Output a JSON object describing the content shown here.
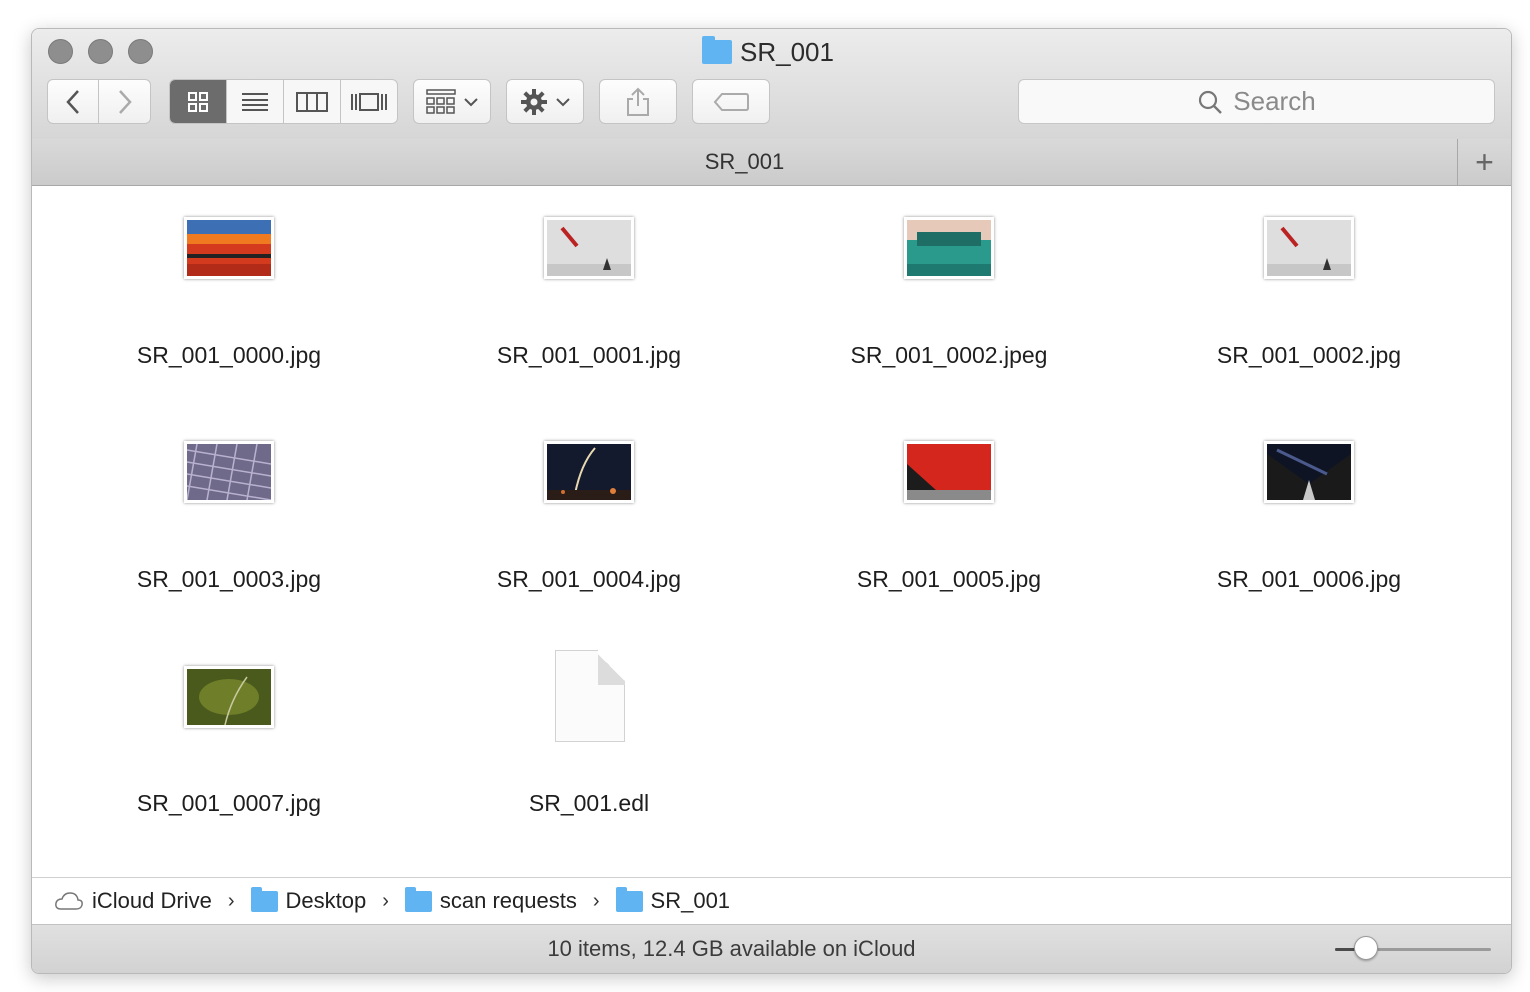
{
  "window": {
    "title": "SR_001",
    "tab_label": "SR_001",
    "tab_add": "+"
  },
  "toolbar": {
    "back": "‹",
    "forward": "›",
    "views": [
      "icon-view",
      "list-view",
      "column-view",
      "cover-flow-view"
    ],
    "active_view": "icon-view",
    "search_placeholder": "Search"
  },
  "files": [
    {
      "name": "SR_001_0000.jpg",
      "kind": "image",
      "thumb": "red-building"
    },
    {
      "name": "SR_001_0001.jpg",
      "kind": "image",
      "thumb": "kite-figure"
    },
    {
      "name": "SR_001_0002.jpeg",
      "kind": "image",
      "thumb": "teal-car"
    },
    {
      "name": "SR_001_0002.jpg",
      "kind": "image",
      "thumb": "kite-figure"
    },
    {
      "name": "SR_001_0003.jpg",
      "kind": "image",
      "thumb": "grid-pattern"
    },
    {
      "name": "SR_001_0004.jpg",
      "kind": "image",
      "thumb": "night-rocket"
    },
    {
      "name": "SR_001_0005.jpg",
      "kind": "image",
      "thumb": "red-wall"
    },
    {
      "name": "SR_001_0006.jpg",
      "kind": "image",
      "thumb": "night-road"
    },
    {
      "name": "SR_001_0007.jpg",
      "kind": "image",
      "thumb": "green-field"
    },
    {
      "name": "SR_001.edl",
      "kind": "document",
      "thumb": "document-icon"
    }
  ],
  "path": [
    {
      "label": "iCloud Drive",
      "icon": "cloud-icon"
    },
    {
      "label": "Desktop",
      "icon": "folder-icon"
    },
    {
      "label": "scan requests",
      "icon": "folder-icon"
    },
    {
      "label": "SR_001",
      "icon": "folder-icon"
    }
  ],
  "status": {
    "text": "10 items, 12.4 GB available on iCloud",
    "icon_size_level": 0.2
  },
  "colors": {
    "folder_blue": "#5fb4f1",
    "active_segment": "#6c6c6c"
  }
}
